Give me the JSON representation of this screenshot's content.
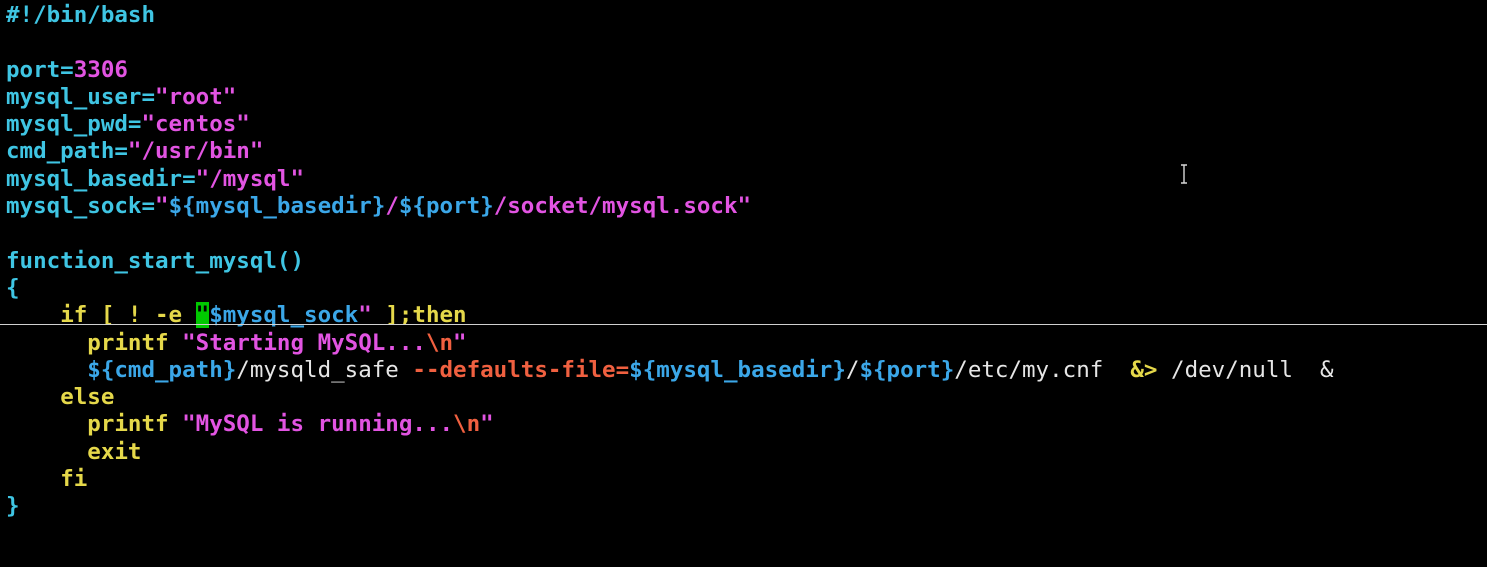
{
  "colors": {
    "background": "#000000",
    "cyan": "#3fc5e3",
    "magenta": "#e254e2",
    "yellow": "#e5d84a",
    "orange": "#f06040",
    "white": "#e6e6e6",
    "blue": "#3ba7e8",
    "cursor": "#00c800"
  },
  "editor": {
    "cursor_line": 12,
    "lines": [
      [
        {
          "t": "#!/bin/bash",
          "c": "cyan"
        }
      ],
      [],
      [
        {
          "t": "port=",
          "c": "cyan"
        },
        {
          "t": "3306",
          "c": "magenta"
        }
      ],
      [
        {
          "t": "mysql_user=",
          "c": "cyan"
        },
        {
          "t": "\"root\"",
          "c": "magenta"
        }
      ],
      [
        {
          "t": "mysql_pwd=",
          "c": "cyan"
        },
        {
          "t": "\"centos\"",
          "c": "magenta"
        }
      ],
      [
        {
          "t": "cmd_path=",
          "c": "cyan"
        },
        {
          "t": "\"/usr/bin\"",
          "c": "magenta"
        }
      ],
      [
        {
          "t": "mysql_basedir=",
          "c": "cyan"
        },
        {
          "t": "\"/mysql\"",
          "c": "magenta"
        }
      ],
      [
        {
          "t": "mysql_sock=",
          "c": "cyan"
        },
        {
          "t": "\"",
          "c": "magenta"
        },
        {
          "t": "${mysql_basedir}",
          "c": "blue"
        },
        {
          "t": "/",
          "c": "magenta"
        },
        {
          "t": "${port}",
          "c": "blue"
        },
        {
          "t": "/socket/mysql.sock\"",
          "c": "magenta"
        }
      ],
      [],
      [
        {
          "t": "function_start_mysql()",
          "c": "cyan"
        }
      ],
      [
        {
          "t": "{",
          "c": "cyan"
        }
      ],
      [
        {
          "t": "    ",
          "c": "white"
        },
        {
          "t": "if [ ! -e ",
          "c": "yellow"
        },
        {
          "t": "\"",
          "c": "magenta",
          "cursor": true
        },
        {
          "t": "$mysql_sock",
          "c": "blue"
        },
        {
          "t": "\"",
          "c": "magenta"
        },
        {
          "t": " ];then",
          "c": "yellow"
        }
      ],
      [
        {
          "t": "      ",
          "c": "white"
        },
        {
          "t": "printf ",
          "c": "yellow"
        },
        {
          "t": "\"Starting MySQL...",
          "c": "magenta"
        },
        {
          "t": "\\n",
          "c": "orange"
        },
        {
          "t": "\"",
          "c": "magenta"
        }
      ],
      [
        {
          "t": "      ",
          "c": "white"
        },
        {
          "t": "${cmd_path}",
          "c": "blue"
        },
        {
          "t": "/mysqld_safe ",
          "c": "white",
          "normal": true
        },
        {
          "t": "--defaults-file=",
          "c": "orange"
        },
        {
          "t": "${mysql_basedir}",
          "c": "blue"
        },
        {
          "t": "/",
          "c": "white",
          "normal": true
        },
        {
          "t": "${port}",
          "c": "blue"
        },
        {
          "t": "/etc/my.cnf  ",
          "c": "white",
          "normal": true
        },
        {
          "t": "&>",
          "c": "yellow"
        },
        {
          "t": " /dev/null  &",
          "c": "white",
          "normal": true
        }
      ],
      [
        {
          "t": "    ",
          "c": "white"
        },
        {
          "t": "else",
          "c": "yellow"
        }
      ],
      [
        {
          "t": "      ",
          "c": "white"
        },
        {
          "t": "printf ",
          "c": "yellow"
        },
        {
          "t": "\"MySQL is running...",
          "c": "magenta"
        },
        {
          "t": "\\n",
          "c": "orange"
        },
        {
          "t": "\"",
          "c": "magenta"
        }
      ],
      [
        {
          "t": "      ",
          "c": "white"
        },
        {
          "t": "exit",
          "c": "yellow"
        }
      ],
      [
        {
          "t": "    ",
          "c": "white"
        },
        {
          "t": "fi",
          "c": "yellow"
        }
      ],
      [
        {
          "t": "}",
          "c": "cyan"
        }
      ]
    ]
  },
  "mouse_pointer": "text-cursor-icon"
}
